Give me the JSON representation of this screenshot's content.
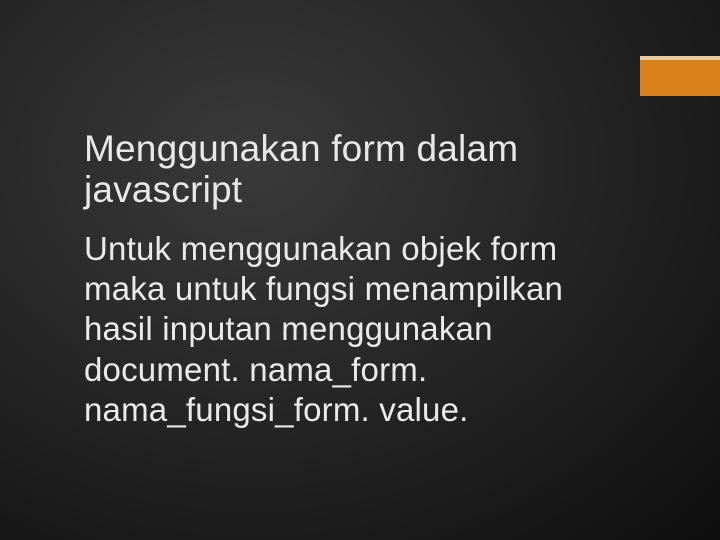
{
  "slide": {
    "title": "Menggunakan form dalam javascript",
    "body": "Untuk menggunakan objek form maka untuk fungsi menampilkan hasil inputan menggunakan document. nama_form. nama_fungsi_form. value."
  }
}
